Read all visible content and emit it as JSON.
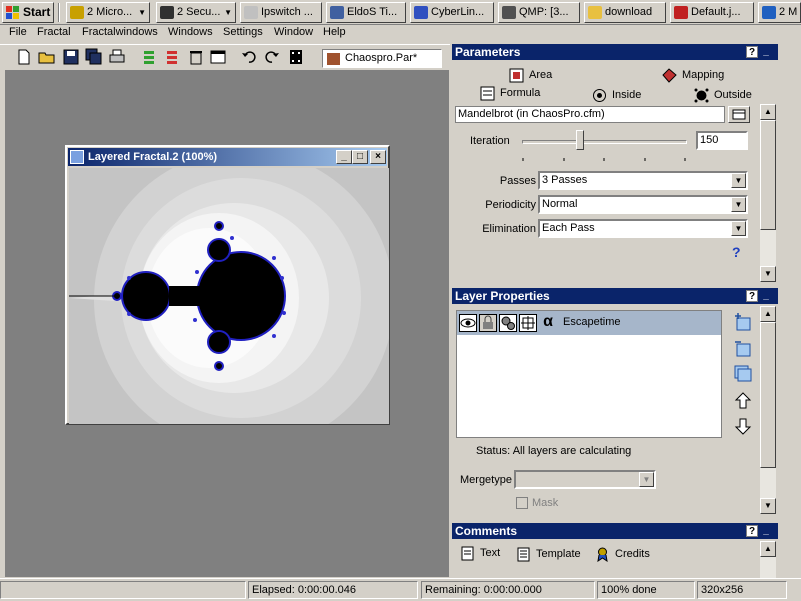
{
  "taskbar": {
    "start_label": "Start",
    "items": [
      {
        "label": "2 Micro...",
        "icon": "folder-clock-icon",
        "color": "#c8a000"
      },
      {
        "label": "2 Secu...",
        "icon": "console-icon",
        "color": "#303030"
      },
      {
        "label": "Ipswitch ...",
        "icon": "ipswitch-icon",
        "color": "#c0c0c0"
      },
      {
        "label": "EldoS Ti...",
        "icon": "eldos-icon",
        "color": "#4060a0"
      },
      {
        "label": "CyberLin...",
        "icon": "cyberlink-icon",
        "color": "#3050c0"
      },
      {
        "label": "QMP: [3...",
        "icon": "qmp-icon",
        "color": "#505050"
      },
      {
        "label": "download",
        "icon": "folder-icon",
        "color": "#e8c040"
      },
      {
        "label": "Default.j...",
        "icon": "red-app-icon",
        "color": "#c02020"
      },
      {
        "label": "2 M",
        "icon": "messenger-icon",
        "color": "#2060c0"
      }
    ]
  },
  "menubar": {
    "items": [
      "File",
      "Fractal",
      "Fractalwindows",
      "Windows",
      "Settings",
      "Window",
      "Help"
    ]
  },
  "toolbar": {
    "parameter_file": "Chaospro.Par*"
  },
  "fractal_window": {
    "title": "Layered Fractal.2 (100%)"
  },
  "parameters": {
    "title": "Parameters",
    "tabs_top": [
      {
        "label": "Area",
        "icon": "area-icon"
      },
      {
        "label": "Mapping",
        "icon": "mapping-icon"
      }
    ],
    "tabs_bottom": [
      {
        "label": "Formula",
        "icon": "formula-icon"
      },
      {
        "label": "Inside",
        "icon": "inside-icon"
      },
      {
        "label": "Outside",
        "icon": "outside-icon"
      }
    ],
    "formula": "Mandelbrot (in ChaosPro.cfm)",
    "iteration_label": "Iteration",
    "iteration_value": "150",
    "iteration_slider_fraction": 0.35,
    "passes_label": "Passes",
    "passes_value": "3 Passes",
    "periodicity_label": "Periodicity",
    "periodicity_value": "Normal",
    "elimination_label": "Elimination",
    "elimination_value": "Each Pass",
    "help_glyph": "?"
  },
  "layer_properties": {
    "title": "Layer Properties",
    "layers": [
      {
        "name": "Escapetime"
      }
    ],
    "alpha_glyph": "α",
    "status": "Status: All layers are calculating",
    "mergetype_label": "Mergetype",
    "mask_label": "Mask"
  },
  "comments": {
    "title": "Comments",
    "tabs": [
      {
        "label": "Text",
        "icon": "text-icon"
      },
      {
        "label": "Template",
        "icon": "template-icon"
      },
      {
        "label": "Credits",
        "icon": "credits-icon"
      }
    ]
  },
  "statusbar": {
    "elapsed": "Elapsed: 0:00:00.046",
    "remaining": "Remaining: 0:00:00.000",
    "progress": "100% done",
    "size": "320x256"
  },
  "panel_buttons": {
    "help": "?",
    "minimize": "_",
    "close": "×"
  }
}
